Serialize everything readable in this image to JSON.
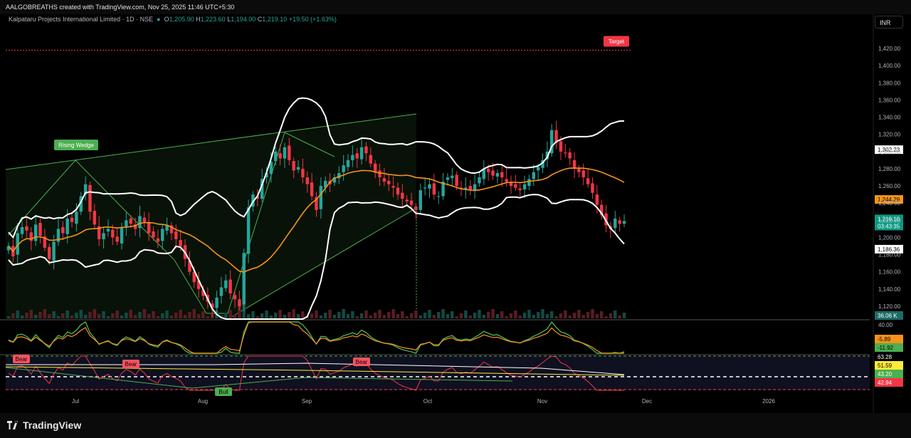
{
  "header": {
    "created_by": "AALGOBREATHS created with TradingView.com, Nov 25, 2025 11:46 UTC+5:30"
  },
  "legend": {
    "symbol": "Kalpataru Projects International Limited · 1D · NSE",
    "o_label": "O",
    "o_value": "1,205.90",
    "h_label": "H",
    "h_value": "1,223.60",
    "l_label": "L",
    "l_value": "1,194.00",
    "c_label": "C",
    "c_value": "1,219.10",
    "change": "+19.50 (+1.63%)"
  },
  "currency_button": "INR",
  "footer": {
    "brand": "TradingView"
  },
  "colors": {
    "up": "#26a69a",
    "down": "#f23645",
    "band": "#ffffff",
    "ma": "#f7931a",
    "wedge": "#4caf50",
    "target": "#f23645",
    "background": "#000000"
  },
  "chart_data": {
    "type": "candlestick",
    "title": "",
    "x_labels": [
      "Jul",
      "Aug",
      "Sep",
      "Oct",
      "Nov",
      "Dec",
      "2026"
    ],
    "y_ticks": [
      "1,120.00",
      "1,140.00",
      "1,160.00",
      "1,180.00",
      "1,200.00",
      "1,220.00",
      "1,240.00",
      "1,260.00",
      "1,280.00",
      "1,300.00",
      "1,320.00",
      "1,340.00",
      "1,360.00",
      "1,380.00",
      "1,400.00",
      "1,420.00"
    ],
    "ylim": [
      1105,
      1440
    ],
    "closes": [
      1190,
      1178,
      1205,
      1212,
      1208,
      1196,
      1215,
      1202,
      1188,
      1175,
      1195,
      1210,
      1205,
      1222,
      1218,
      1230,
      1248,
      1262,
      1230,
      1215,
      1198,
      1205,
      1210,
      1200,
      1195,
      1212,
      1220,
      1216,
      1210,
      1225,
      1218,
      1205,
      1200,
      1195,
      1210,
      1214,
      1205,
      1198,
      1190,
      1175,
      1160,
      1148,
      1140,
      1132,
      1125,
      1118,
      1130,
      1142,
      1150,
      1135,
      1128,
      1120,
      1182,
      1235,
      1250,
      1245,
      1268,
      1275,
      1288,
      1300,
      1292,
      1305,
      1290,
      1278,
      1282,
      1270,
      1262,
      1248,
      1232,
      1260,
      1266,
      1262,
      1270,
      1275,
      1284,
      1290,
      1296,
      1292,
      1305,
      1298,
      1286,
      1276,
      1270,
      1265,
      1262,
      1258,
      1250,
      1245,
      1242,
      1238,
      1232,
      1255,
      1258,
      1262,
      1250,
      1248,
      1265,
      1270,
      1272,
      1260,
      1256,
      1258,
      1255,
      1262,
      1270,
      1280,
      1276,
      1272,
      1275,
      1270,
      1265,
      1260,
      1258,
      1255,
      1262,
      1268,
      1276,
      1282,
      1290,
      1300,
      1325,
      1310,
      1300,
      1298,
      1292,
      1280,
      1276,
      1270,
      1262,
      1252,
      1238,
      1226,
      1214,
      1210,
      1222,
      1216,
      1219.1
    ],
    "series": [
      {
        "name": "",
        "last_value": "1,302.23"
      },
      {
        "name": "",
        "last_value": "1,244.29"
      },
      {
        "name": "",
        "last_value": "1,186.36"
      }
    ],
    "last_price": "1,219.10",
    "countdown": "03:43:35",
    "volume_label": "36.06 K",
    "target_label": "Target",
    "target_value": 1418,
    "pattern_label": "Rising Wedge",
    "osc1": {
      "ticks": [
        "40.00"
      ],
      "values": [
        "-5.89",
        "-11.92"
      ]
    },
    "osc2": {
      "values": [
        "63.28",
        "51.59",
        "43.20",
        "42.94"
      ]
    },
    "signals": [
      "Bear",
      "Bear",
      "Bear",
      "Bull"
    ]
  }
}
